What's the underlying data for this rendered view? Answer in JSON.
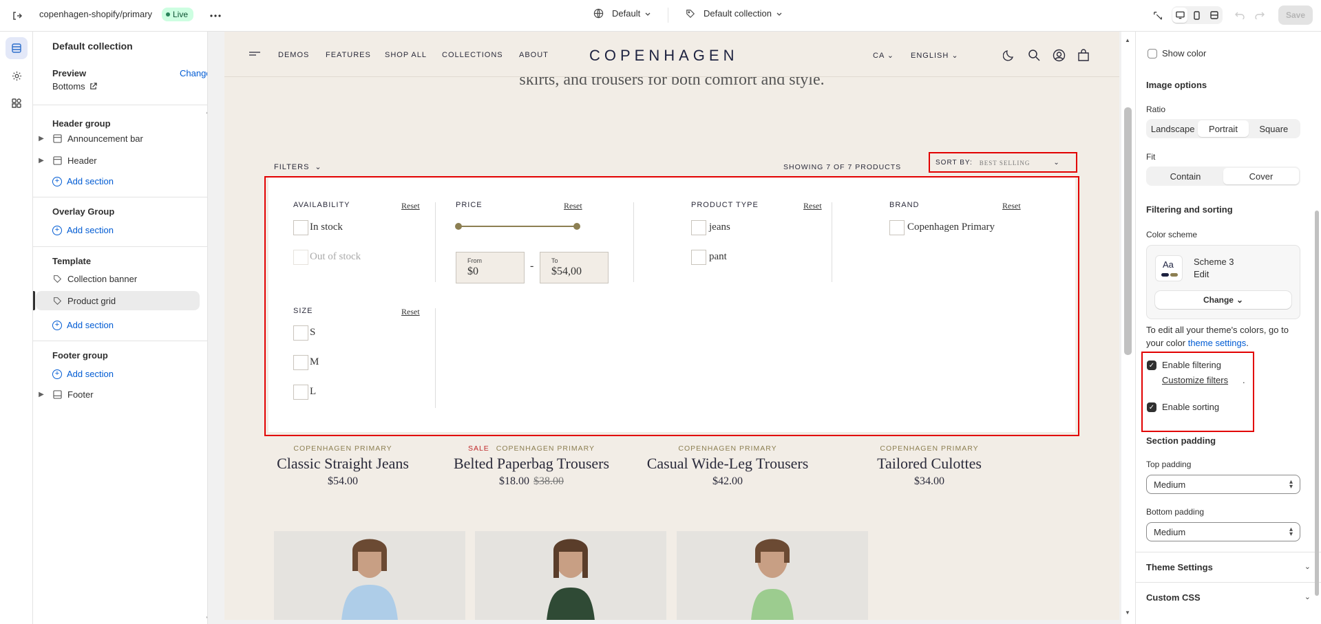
{
  "topbar": {
    "store_name": "copenhagen-shopify/primary",
    "status": "Live",
    "theme_select": "Default",
    "template_select": "Default collection",
    "save_label": "Save"
  },
  "left_panel": {
    "title": "Default collection",
    "preview_label": "Preview",
    "change_label": "Change",
    "preview_value": "Bottoms",
    "header_group": {
      "label": "Header group",
      "items": [
        "Announcement bar",
        "Header"
      ],
      "add_label": "Add section"
    },
    "overlay_group": {
      "label": "Overlay Group",
      "add_label": "Add section"
    },
    "template": {
      "label": "Template",
      "items": [
        "Collection banner",
        "Product grid"
      ],
      "add_label": "Add section"
    },
    "footer_group": {
      "label": "Footer group",
      "add_label": "Add section",
      "items": [
        "Footer"
      ]
    }
  },
  "store": {
    "nav": [
      "DEMOS",
      "FEATURES",
      "SHOP ALL",
      "COLLECTIONS",
      "ABOUT"
    ],
    "logo": "COPENHAGEN",
    "country": "CA",
    "language": "ENGLISH",
    "tagline": "skirts, and trousers for both comfort and style.",
    "filters_label": "FILTERS",
    "showing": "SHOWING 7 OF 7 PRODUCTS",
    "sort_label": "SORT BY:",
    "sort_value": "BEST SELLING",
    "filters": {
      "availability": {
        "title": "AVAILABILITY",
        "reset": "Reset",
        "options": [
          "In stock",
          "Out of stock"
        ]
      },
      "price": {
        "title": "PRICE",
        "reset": "Reset",
        "from_label": "From",
        "from_value": "$0",
        "to_label": "To",
        "to_value": "$54,00",
        "dash": "-"
      },
      "product_type": {
        "title": "PRODUCT TYPE",
        "reset": "Reset",
        "options": [
          "jeans",
          "pant"
        ]
      },
      "brand": {
        "title": "BRAND",
        "reset": "Reset",
        "options": [
          "Copenhagen Primary"
        ]
      },
      "size": {
        "title": "SIZE",
        "reset": "Reset",
        "options": [
          "S",
          "M",
          "L"
        ]
      }
    },
    "products": [
      {
        "vendor": "COPENHAGEN PRIMARY",
        "sale": "",
        "name": "Classic Straight Jeans",
        "price": "$54.00",
        "compare": ""
      },
      {
        "vendor": "COPENHAGEN PRIMARY",
        "sale": "SALE",
        "name": "Belted Paperbag Trousers",
        "price": "$18.00",
        "compare": "$38.00"
      },
      {
        "vendor": "COPENHAGEN PRIMARY",
        "sale": "",
        "name": "Casual Wide-Leg Trousers",
        "price": "$42.00",
        "compare": ""
      },
      {
        "vendor": "COPENHAGEN PRIMARY",
        "sale": "",
        "name": "Tailored Culottes",
        "price": "$34.00",
        "compare": ""
      }
    ],
    "image_colors": [
      "#aecde8",
      "#2f4a35",
      "#9ccc8f"
    ]
  },
  "right_panel": {
    "show_color": "Show color",
    "image_options": "Image options",
    "ratio_label": "Ratio",
    "ratio_options": [
      "Landscape",
      "Portrait",
      "Square"
    ],
    "ratio_selected": "Portrait",
    "fit_label": "Fit",
    "fit_options": [
      "Contain",
      "Cover"
    ],
    "fit_selected": "Cover",
    "filtering_heading": "Filtering and sorting",
    "color_scheme_label": "Color scheme",
    "scheme_name": "Scheme 3",
    "scheme_sample": "Aa",
    "edit_label": "Edit",
    "change_label": "Change",
    "help_text_1": "To edit all your theme's colors, go to",
    "help_text_2": "your color",
    "help_link": "theme settings",
    "help_end": ".",
    "enable_filtering": "Enable filtering",
    "customize_filters": "Customize filters",
    "enable_sorting": "Enable sorting",
    "section_padding": "Section padding",
    "top_padding_label": "Top padding",
    "top_padding_value": "Medium",
    "bottom_padding_label": "Bottom padding",
    "bottom_padding_value": "Medium",
    "theme_settings": "Theme Settings",
    "custom_css": "Custom CSS"
  },
  "colors": {
    "accent": "#005bd3",
    "highlight": "#e20000",
    "gold": "#8c7f52",
    "navy": "#1d2240"
  }
}
